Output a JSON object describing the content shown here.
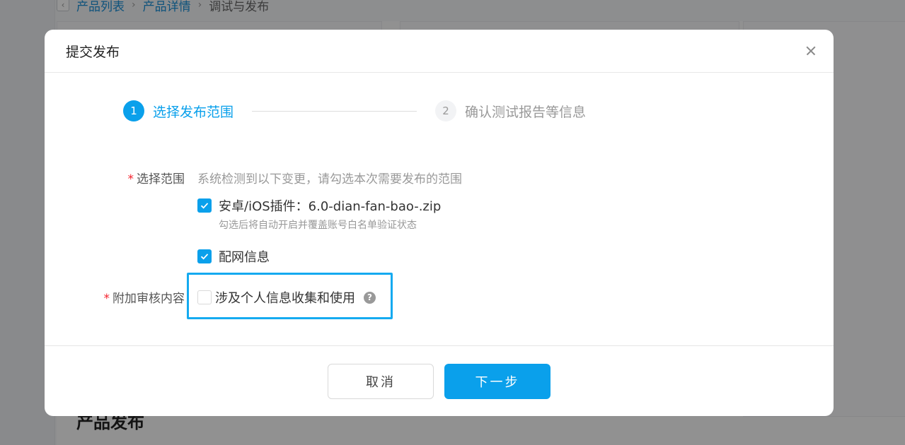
{
  "background": {
    "breadcrumb": [
      "产品列表",
      "产品详情",
      "调试与发布"
    ],
    "section_title": "产品发布"
  },
  "modal": {
    "title": "提交发布",
    "steps": [
      {
        "number": "1",
        "label": "选择发布范围",
        "state": "active"
      },
      {
        "number": "2",
        "label": "确认测试报告等信息",
        "state": "inactive"
      }
    ],
    "scope": {
      "label": "选择范围",
      "hint": "系统检测到以下变更，请勾选本次需要发布的范围",
      "options": [
        {
          "label": "安卓/iOS插件：6.0-dian-fan-bao-.zip",
          "checked": true,
          "sub_hint": "勾选后将自动开启并覆盖账号白名单验证状态"
        },
        {
          "label": "配网信息",
          "checked": true
        }
      ]
    },
    "extra": {
      "label": "附加审核内容",
      "option": {
        "label": "涉及个人信息收集和使用",
        "checked": false
      },
      "help": "?"
    },
    "required_mark": "*",
    "buttons": {
      "cancel": "取消",
      "next": "下一步"
    }
  },
  "colors": {
    "accent": "#0aa0eb",
    "highlight": "#15aaf0",
    "required": "#f5222d"
  }
}
